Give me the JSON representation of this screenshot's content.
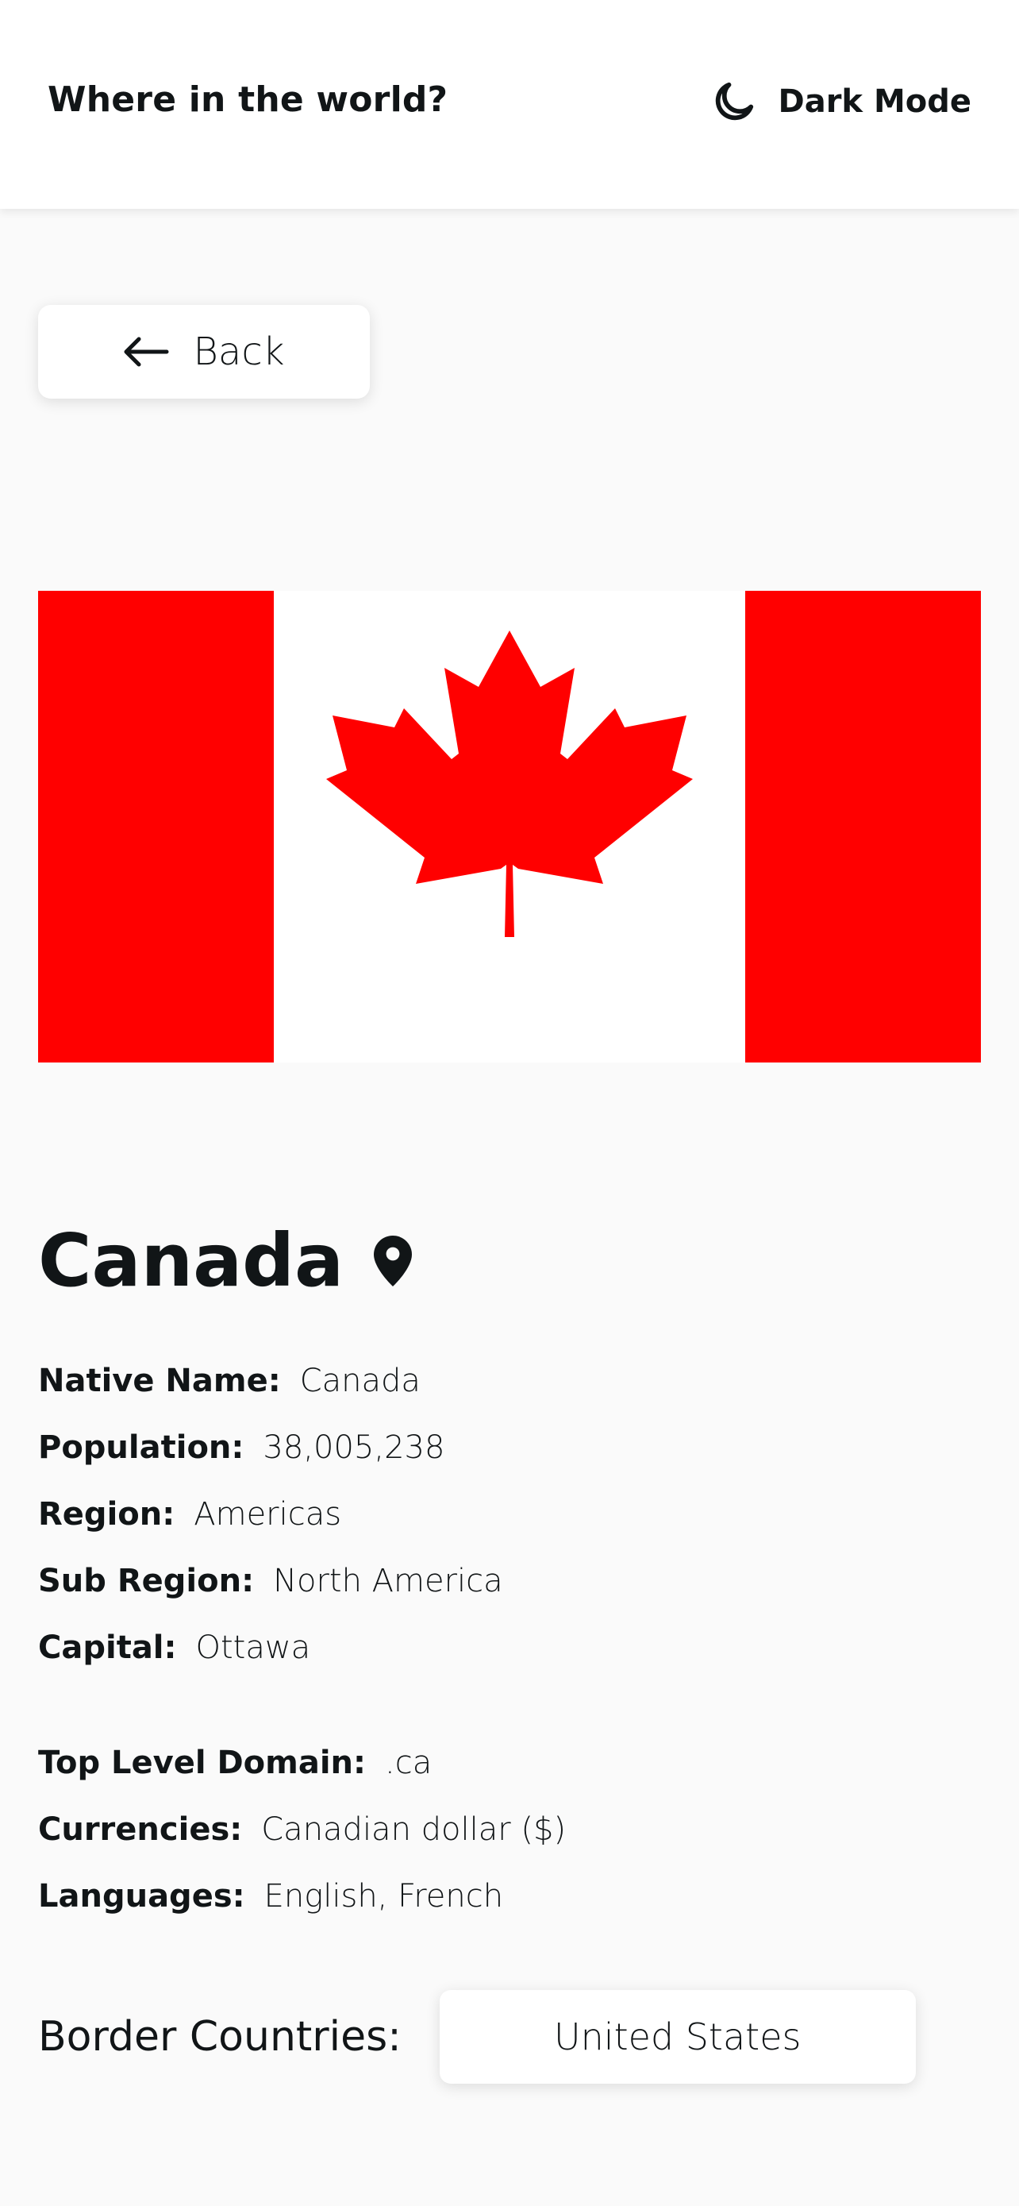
{
  "header": {
    "title": "Where in the world?",
    "mode_toggle_label": "Dark Mode",
    "mode_icon": "moon-icon"
  },
  "back_button": {
    "label": "Back",
    "icon": "arrow-left-icon"
  },
  "flag": {
    "icon": "canada-flag",
    "colors": {
      "red": "#ff0000",
      "white": "#ffffff"
    }
  },
  "country": {
    "name": "Canada",
    "pin_icon": "map-pin-icon",
    "details_primary": [
      {
        "label": "Native Name:",
        "value": "Canada"
      },
      {
        "label": "Population:",
        "value": "38,005,238"
      },
      {
        "label": "Region:",
        "value": "Americas"
      },
      {
        "label": "Sub Region:",
        "value": "North America"
      },
      {
        "label": "Capital:",
        "value": "Ottawa"
      }
    ],
    "details_secondary": [
      {
        "label": "Top Level Domain:",
        "value": ".ca"
      },
      {
        "label": "Currencies:",
        "value": "Canadian dollar ($)"
      },
      {
        "label": "Languages:",
        "value": "English, French"
      }
    ],
    "border_countries_label": "Border Countries:",
    "border_countries": [
      "United States"
    ]
  },
  "colors": {
    "background": "#fafafa",
    "surface": "#ffffff",
    "text": "#111517"
  }
}
